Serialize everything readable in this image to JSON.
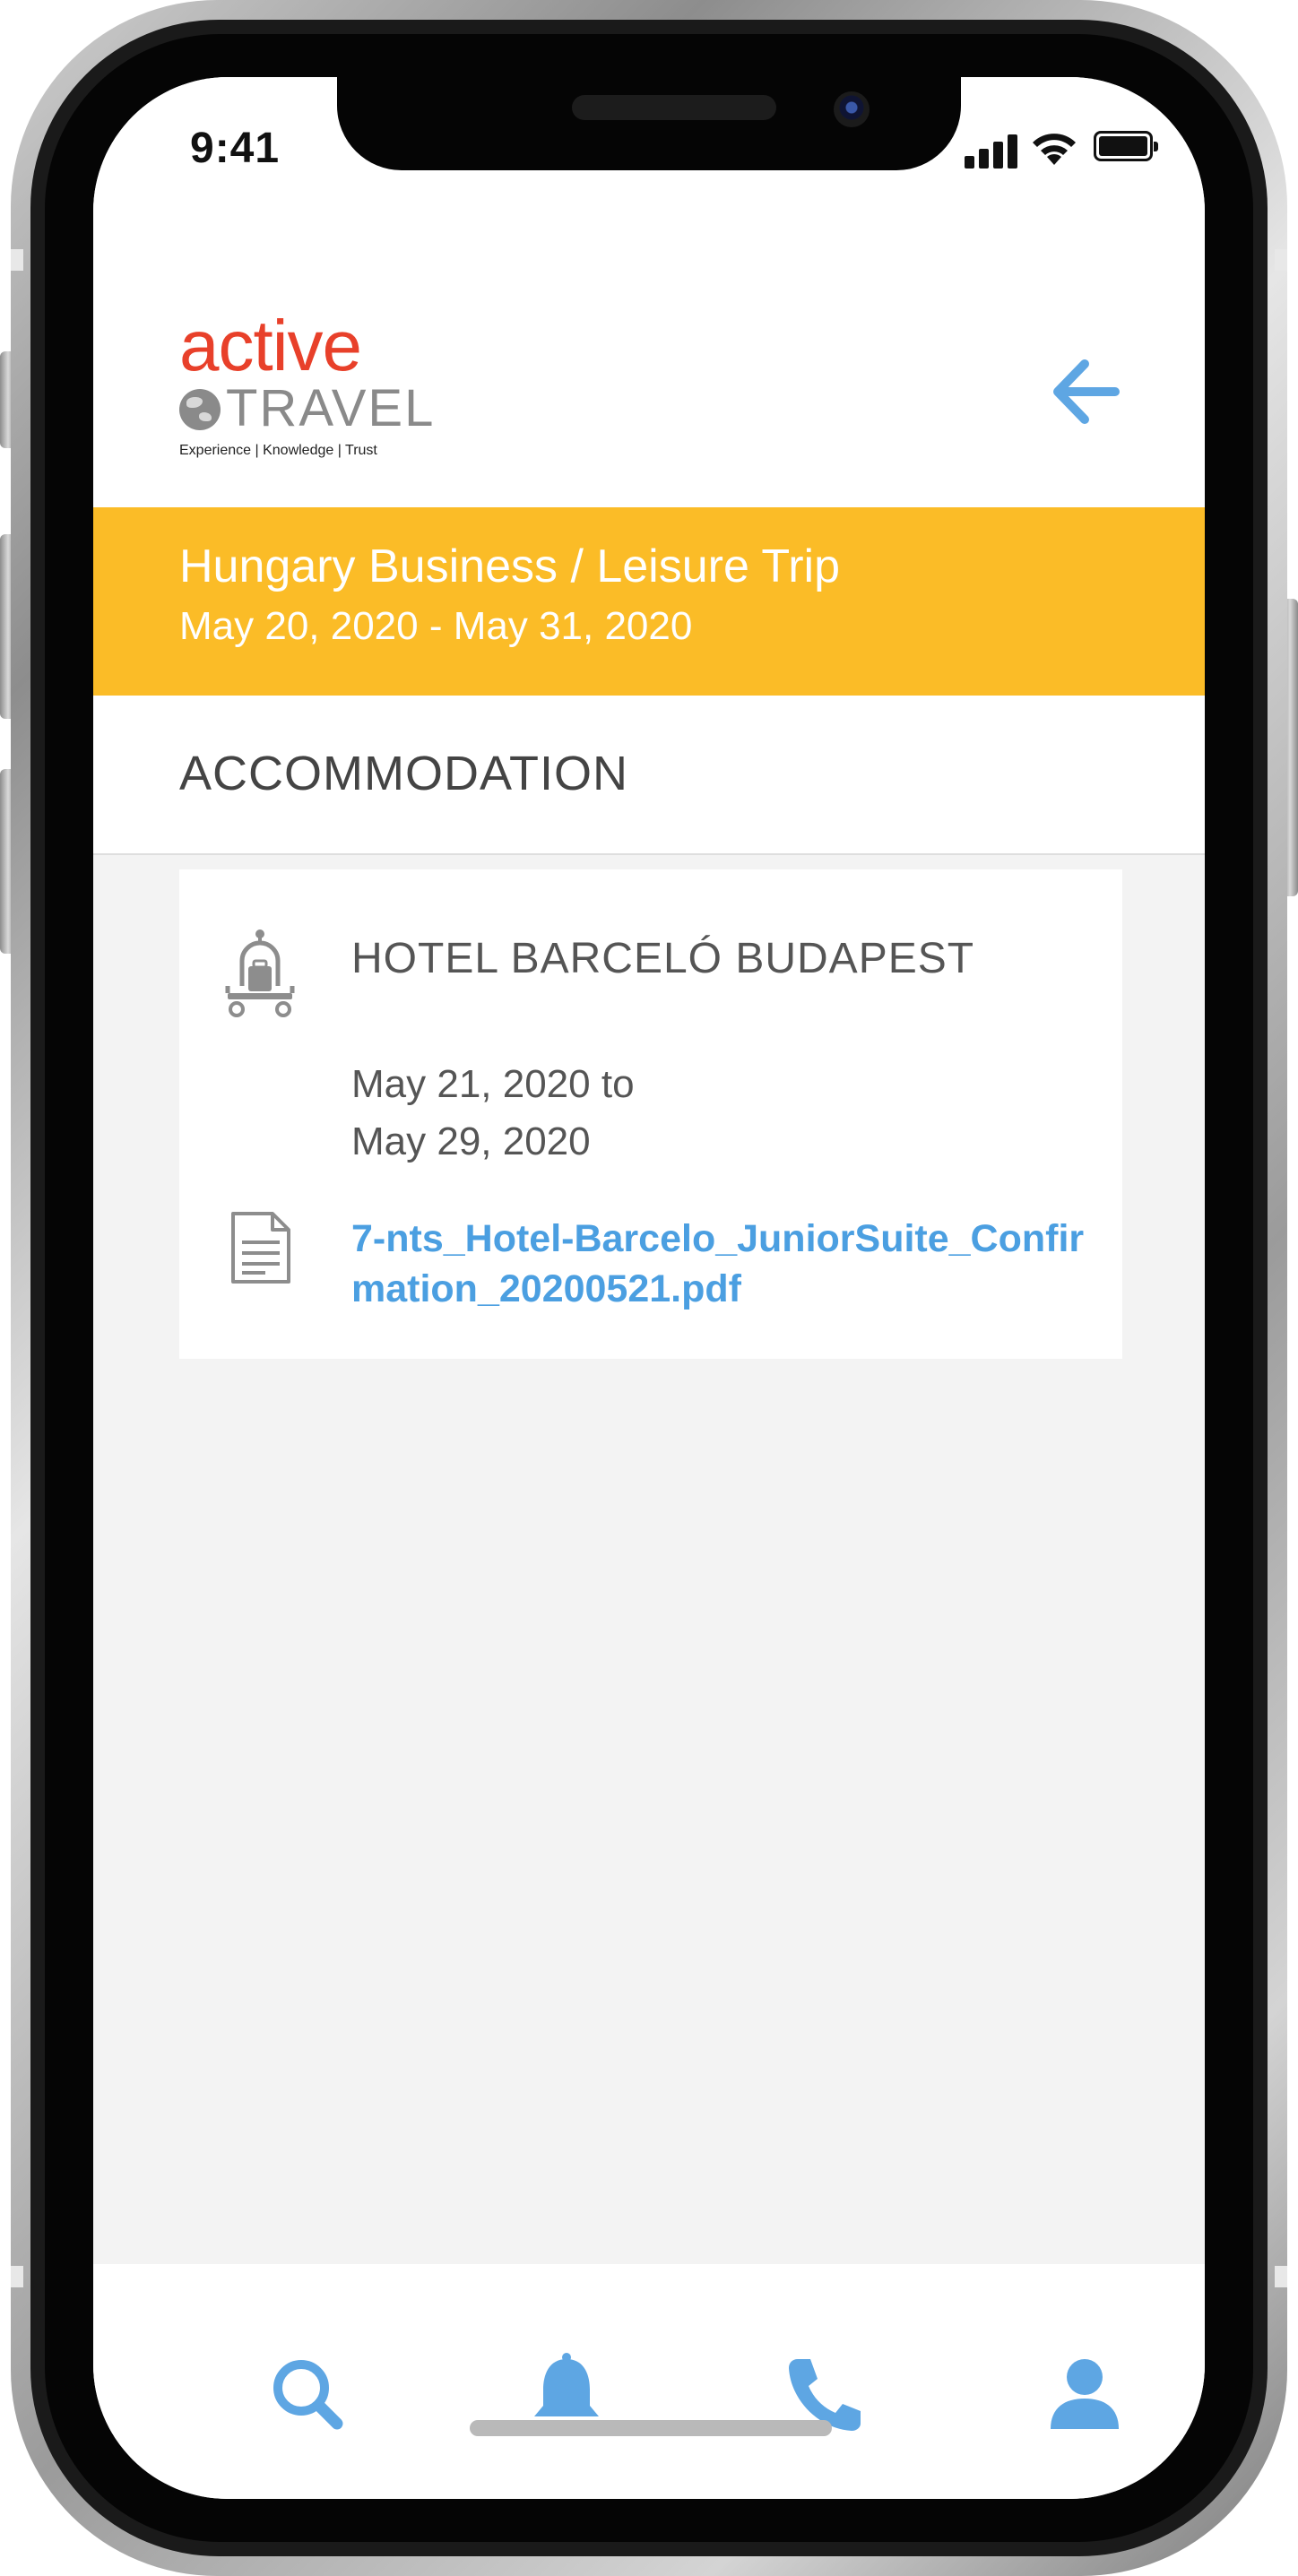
{
  "status_bar": {
    "time": "9:41"
  },
  "header": {
    "logo": {
      "brand_top": "active",
      "brand_bottom": "TRAVEL",
      "tagline": "Experience | Knowledge | Trust"
    },
    "back_icon": "arrow-left-icon"
  },
  "trip": {
    "title": "Hungary Business / Leisure Trip",
    "dates": "May 20, 2020 - May 31, 2020"
  },
  "section": {
    "title": "ACCOMMODATION"
  },
  "accommodation": {
    "icon": "hotel-bell-icon",
    "hotel_name": "HOTEL BARCELÓ BUDAPEST",
    "date_from": "May 21, 2020 to",
    "date_to": "May 29, 2020",
    "document_icon": "document-icon",
    "document_name": "7-nts_Hotel-Barcelo_JuniorSuite_Confirmation_20200521.pdf"
  },
  "tab_bar": {
    "tabs": [
      {
        "icon": "search-icon"
      },
      {
        "icon": "bell-icon"
      },
      {
        "icon": "phone-icon"
      },
      {
        "icon": "user-icon"
      }
    ]
  },
  "colors": {
    "brand_red": "#e8402a",
    "banner_yellow": "#fbbc27",
    "accent_blue": "#4b9fe1",
    "text_gray": "#555555"
  }
}
